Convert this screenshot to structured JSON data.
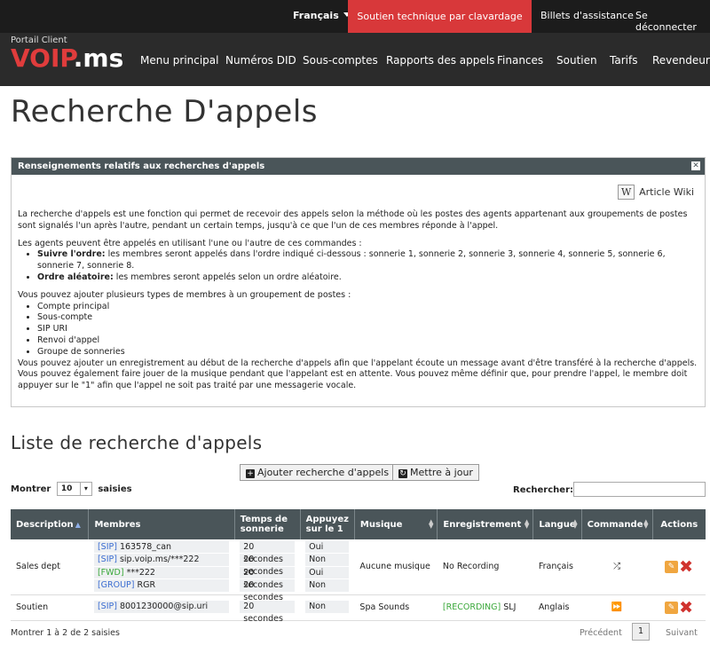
{
  "topbar": {
    "language": "Français",
    "chat_support": "Soutien technique par clavardage",
    "tickets": "Billets d'assistance",
    "logout": "Se déconnecter"
  },
  "brand": {
    "portal_label": "Portail Client",
    "logo_part1": "VOIP",
    "logo_part2": ".ms"
  },
  "nav": {
    "items": [
      "Menu principal",
      "Numéros DID",
      "Sous-comptes",
      "Rapports des appels",
      "Finances",
      "Soutien",
      "Tarifs",
      "Revendeur"
    ]
  },
  "page_title": "Recherche D'appels",
  "info_panel": {
    "title": "Renseignements relatifs aux recherches d'appels",
    "wiki_icon": "W",
    "wiki_label": "Article Wiki",
    "para1": "La recherche d'appels est une fonction qui permet de recevoir des appels selon la méthode où les postes des agents appartenant aux groupements de postes sont signalés l'un après l'autre, pendant un certain temps, jusqu'à ce que l'un de ces membres réponde à l'appel.",
    "para2": "Les agents peuvent être appelés en utilisant l'une ou l'autre de ces commandes :",
    "cmd1_bold": "Suivre l'ordre:",
    "cmd1_text": " les membres seront appelés dans l'ordre indiqué ci-dessous : sonnerie 1, sonnerie 2, sonnerie 3, sonnerie 4, sonnerie 5, sonnerie 6, sonnerie 7, sonnerie 8.",
    "cmd2_bold": "Ordre aléatoire:",
    "cmd2_text": " les membres seront appelés selon un ordre aléatoire.",
    "para3": "Vous pouvez ajouter plusieurs types de membres à un groupement de postes :",
    "member_types": [
      "Compte principal",
      "Sous-compte",
      "SIP URI",
      "Renvoi d'appel",
      "Groupe de sonneries"
    ],
    "para4": "Vous pouvez ajouter un enregistrement au début de la recherche d'appels afin que l'appelant écoute un message avant d'être transféré à la recherche d'appels.",
    "para5": "Vous pouvez également faire jouer de la musique pendant que l'appelant est en attente. Vous pouvez même définir que, pour prendre l'appel, le membre doit appuyer sur le \"1\" afin que l'appel ne soit pas traité par une messagerie vocale."
  },
  "list": {
    "title": "Liste de recherche d'appels",
    "add_button": "Ajouter recherche d'appels",
    "refresh_button": "Mettre à jour",
    "show_label": "Montrer",
    "show_value": "10",
    "entries_label": "saisies",
    "search_label": "Rechercher:",
    "search_value": "",
    "columns": [
      "Description",
      "Membres",
      "Temps de sonnerie",
      "Appuyez sur le 1",
      "Musique",
      "Enregistrement",
      "Langue",
      "Commande",
      "Actions"
    ],
    "rows": [
      {
        "description": "Sales dept",
        "members": [
          {
            "tag": "[SIP]",
            "value": "163578_can",
            "kind": "sip"
          },
          {
            "tag": "[SIP]",
            "value": "sip.voip.ms/***222",
            "kind": "sip"
          },
          {
            "tag": "[FWD]",
            "value": "***222",
            "kind": "fwd"
          },
          {
            "tag": "[GROUP]",
            "value": "RGR",
            "kind": "grp"
          }
        ],
        "ring_times": [
          "20 secondes",
          "20 secondes",
          "20 secondes",
          "20 secondes"
        ],
        "press1": [
          "Oui",
          "Non",
          "Oui",
          "Non"
        ],
        "music": "Aucune musique",
        "recording_tag": "",
        "recording": "No Recording",
        "language": "Français",
        "command_icon": "⤮"
      },
      {
        "description": "Soutien",
        "members": [
          {
            "tag": "[SIP]",
            "value": "8001230000@sip.uri",
            "kind": "sip"
          }
        ],
        "ring_times": [
          "20 secondes"
        ],
        "press1": [
          "Non"
        ],
        "music": "Spa Sounds",
        "recording_tag": "[RECORDING]",
        "recording": "SLJ",
        "language": "Anglais",
        "command_icon": "⏩"
      }
    ],
    "footer_info": "Montrer 1 à 2 de 2 saisies",
    "prev": "Précédent",
    "page": "1",
    "next": "Suivant"
  }
}
